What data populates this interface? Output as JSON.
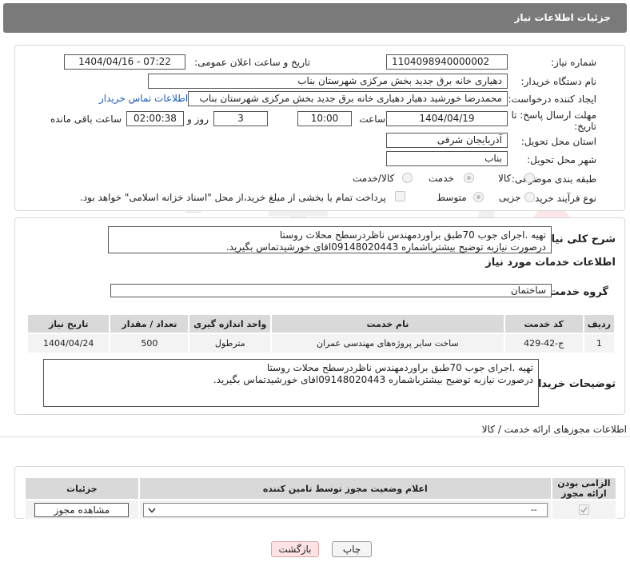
{
  "page": {
    "title": "جزئیات اطلاعات نیاز"
  },
  "info": {
    "need_number_label": "شماره نیاز:",
    "need_number": "1104098940000002",
    "announce_label": "تاریخ و ساعت اعلان عمومی:",
    "announce_value": "1404/04/16 - 07:22",
    "buyer_org_label": "نام دستگاه خریدار:",
    "buyer_org": "دهیاری خانه برق جدید بخش مرکزی شهرستان بناب",
    "creator_label": "ایجاد کننده درخواست:",
    "creator": "محمدرضا خورشید دهیار دهیاری خانه برق جدید بخش مرکزی شهرستان بناب",
    "contact_link": "اطلاعات تماس خریدار",
    "deadline_label_1": "مهلت ارسال پاسخ: تا",
    "deadline_label_2": "تاریخ:",
    "deadline_date": "1404/04/19",
    "time_label": "ساعت",
    "deadline_time": "10:00",
    "days_value": "3",
    "days_label": "روز و",
    "remaining_value": "02:00:38",
    "remaining_label": "ساعت باقی مانده",
    "province_label": "استان محل تحویل:",
    "province": "آذربایجان شرقی",
    "city_label": "شهر محل تحویل:",
    "city": "بناب",
    "category_label": "طبقه بندی موضوعی:",
    "category_options": [
      "کالا",
      "خدمت",
      "کالا/خدمت"
    ],
    "process_label": "نوع فرآیند خرید :",
    "process_options": [
      "جزیی",
      "متوسط"
    ],
    "payment_note": "پرداخت تمام یا بخشی از مبلغ خرید،از محل \"اسناد خزانه اسلامی\" خواهد بود."
  },
  "summary": {
    "label": "شرح کلی نیاز:",
    "line1": "تهیه .اجرای جوب 70طبق براوردمهندس ناظردرسطح محلات روستا",
    "line2": "درصورت نیازبه توضیح بیشترباشماره 09148020443اقای خورشیدتماس بگیرید."
  },
  "services": {
    "title": "اطلاعات خدمات مورد نیاز",
    "group_label": "گروه خدمت:",
    "group_value": "ساختمان",
    "headers": [
      "ردیف",
      "کد خدمت",
      "نام خدمت",
      "واحد اندازه گیری",
      "تعداد / مقدار",
      "تاریخ نیاز"
    ],
    "rows": [
      [
        "1",
        "ج-42-429",
        "ساخت سایر پروژه‌های مهندسی عمران",
        "مترطول",
        "500",
        "1404/04/24"
      ]
    ]
  },
  "buyer_notes": {
    "label": "توضیحات خریدار:",
    "line1": "تهیه .اجرای جوب 70طبق براوردمهندس ناظردرسطح محلات روستا",
    "line2": "درصورت نیازبه توضیح بیشترباشماره 09148020443اقای خورشیدتماس بگیرید."
  },
  "permits": {
    "title": "اطلاعات مجوزهای ارائه خدمت / کالا",
    "headers": [
      "الزامی بودن ارائه مجوز",
      "اعلام وضعیت مجوز توسط تامین کننده",
      "جزئیات"
    ],
    "select_value": "--",
    "view_button": "مشاهده مجوز"
  },
  "actions": {
    "print": "چاپ",
    "back": "بازگشت"
  },
  "colors": {
    "header_bg": "#7a7a7a",
    "link": "#1a5bb8",
    "back_btn_bg": "#fde3e3"
  }
}
